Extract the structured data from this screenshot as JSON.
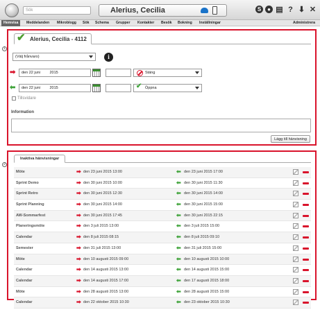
{
  "topbar": {
    "search_placeholder": "Sök",
    "user_name": "Alerius, Cecilia",
    "icons": [
      "globe-icon",
      "phone-icon",
      "mobile-icon",
      "circle-s-icon",
      "world-icon",
      "print-icon",
      "help-icon",
      "download-icon",
      "close-icon"
    ]
  },
  "nav": {
    "items": [
      "Hemvisa",
      "Meddelanden",
      "Mikroblogg",
      "Sök",
      "Schema",
      "Grupper",
      "Kontakter",
      "Besök",
      "Bokning",
      "Inställningar"
    ],
    "right": "Administrera"
  },
  "panel1": {
    "marker": "1",
    "tab_title": "Alerius, Cecilia - 4112",
    "select_value": "(Välj frånvaro)",
    "from_date": "den 22 juni",
    "from_year": "2015",
    "from_action": "Stäng",
    "to_date": "den 22 juni",
    "to_year": "2015",
    "to_action": "Öppna",
    "checkbox_label": "Tillsvidare",
    "info_label": "Information",
    "add_button": "Lägg till hänvisning"
  },
  "panel2": {
    "marker": "2",
    "tab_title": "Inaktiva hänvisningar",
    "rows": [
      {
        "name": "Möte",
        "from": "den 23 juni 2015 13:00",
        "to": "den 23 juni 2015 17:00"
      },
      {
        "name": "Sprint Demo",
        "from": "den 30 juni 2015 10:00",
        "to": "den 30 juni 2015 11:30"
      },
      {
        "name": "Sprint Retro",
        "from": "den 30 juni 2015 12:30",
        "to": "den 30 juni 2015 14:00"
      },
      {
        "name": "Sprint Planning",
        "from": "den 30 juni 2015 14:00",
        "to": "den 30 juni 2015 15:00"
      },
      {
        "name": "AW-Sommarfest",
        "from": "den 30 juni 2015 17:45",
        "to": "den 30 juni 2015 22:15"
      },
      {
        "name": "Planeringsmöte",
        "from": "den 3 juli 2015 13:00",
        "to": "den 3 juli 2015 15:00"
      },
      {
        "name": "Calendar",
        "from": "den 8 juli 2015 08:15",
        "to": "den 8 juli 2015 09:10"
      },
      {
        "name": "Semester",
        "from": "den 31 juli 2015 13:00",
        "to": "den 31 juli 2015 15:00"
      },
      {
        "name": "Möte",
        "from": "den 10 augusti 2015 09:00",
        "to": "den 10 augusti 2015 10:00"
      },
      {
        "name": "Calendar",
        "from": "den 14 augusti 2015 13:00",
        "to": "den 14 augusti 2015 15:00"
      },
      {
        "name": "Calendar",
        "from": "den 14 augusti 2015 17:00",
        "to": "den 17 augusti 2015 18:00"
      },
      {
        "name": "Möte",
        "from": "den 28 augusti 2015 13:00",
        "to": "den 28 augusti 2015 15:00"
      },
      {
        "name": "Calendar",
        "from": "den 22 oktober 2015 10:30",
        "to": "den 23 oktober 2015 10:30"
      }
    ]
  },
  "colors": {
    "highlight": "#d9132b",
    "green": "#3fa33a",
    "nav_active": "#666666"
  }
}
